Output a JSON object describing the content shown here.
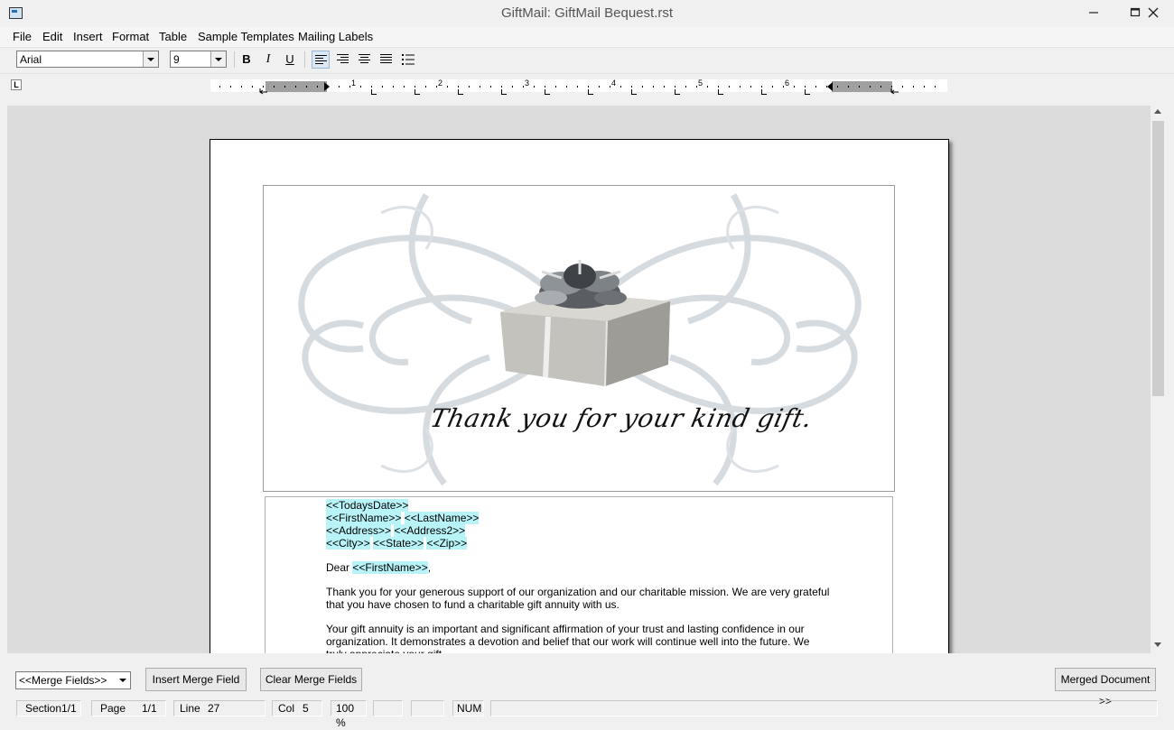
{
  "window": {
    "title": "GiftMail:   GiftMail Bequest.rst"
  },
  "menu": [
    "File",
    "Edit",
    "Insert",
    "Format",
    "Table",
    "Sample Templates",
    "Mailing Labels"
  ],
  "toolbar": {
    "font_name": "Arial",
    "font_size": "9",
    "bold_label": "B",
    "italic_label": "I",
    "underline_label": "U",
    "buttons": [
      "bold-button",
      "italic-button",
      "underline-button",
      "align-left-button",
      "align-right-button",
      "align-center-button",
      "justify-button",
      "bullet-list-button"
    ]
  },
  "ruler": {
    "tab_selector_label": "L",
    "numbers": [
      "1",
      "2",
      "3",
      "4",
      "5",
      "6"
    ]
  },
  "document": {
    "header_text": "Thank you for your kind gift.",
    "fields": {
      "date": "<<TodaysDate>>",
      "first_name": "<<FirstName>>",
      "last_name": "<<LastName>>",
      "address": "<<Address>>",
      "address2": "<<Address2>>",
      "city": "<<City>>",
      "state": "<<State>>",
      "zip": "<<Zip>>"
    },
    "salutation_prefix": "Dear",
    "salutation_suffix": ",",
    "paragraph1": "Thank you for your generous support of our organization and our charitable mission. We are very grateful that you have chosen to fund a charitable gift annuity with us.",
    "paragraph2": "Your gift annuity is an important and significant affirmation of your trust and lasting confidence in our organization. It demonstrates a devotion and belief that our work will continue well into the future. We truly appreciate your gift."
  },
  "bottom": {
    "merge_field_select": "<<Merge Fields>>",
    "insert_merge_field": "Insert Merge Field",
    "clear_merge_fields": "Clear Merge Fields",
    "merged_document": "Merged Document >>"
  },
  "status": {
    "section": "Section1/1",
    "page_label": "Page",
    "page_value": "1/1",
    "line_label": "Line",
    "line_value": "27",
    "col_label": "Col",
    "col_value": "5",
    "zoom": "100 %",
    "num": "NUM"
  },
  "colors": {
    "merge_field_highlight": "#b8f3f8",
    "doc_background": "#dcdcdc",
    "ruler_margin": "#a0a0a0"
  }
}
